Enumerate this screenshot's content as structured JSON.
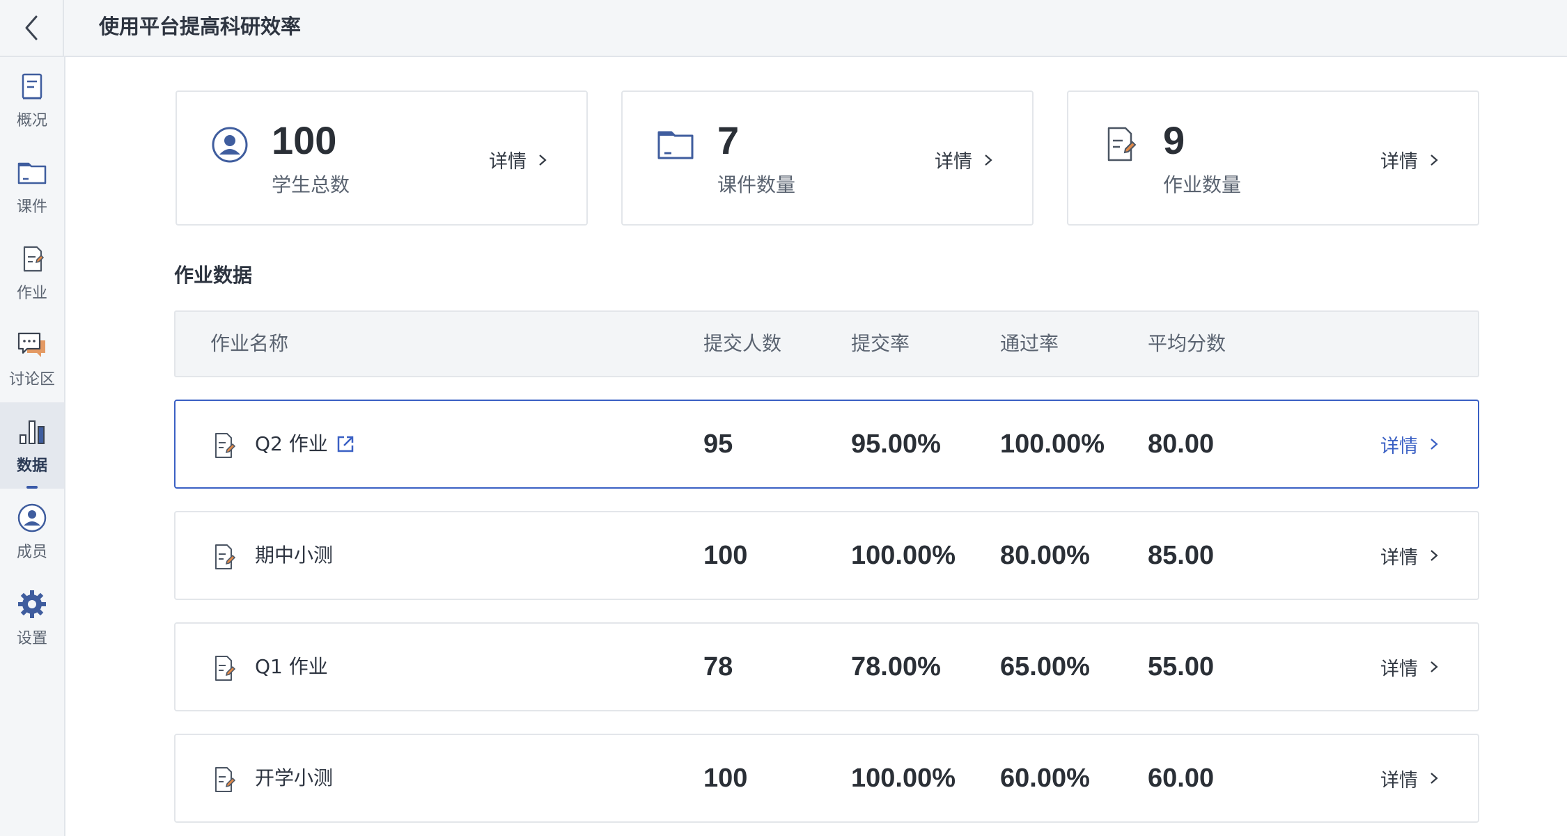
{
  "header": {
    "title": "使用平台提高科研效率",
    "back_icon": "chevron-left-icon"
  },
  "sidebar": {
    "items": [
      {
        "label": "概况",
        "icon": "overview-doc-icon"
      },
      {
        "label": "课件",
        "icon": "folder-icon"
      },
      {
        "label": "作业",
        "icon": "assignment-icon"
      },
      {
        "label": "讨论区",
        "icon": "chat-icon"
      },
      {
        "label": "数据",
        "icon": "bar-chart-icon",
        "active": true
      },
      {
        "label": "成员",
        "icon": "user-icon"
      },
      {
        "label": "设置",
        "icon": "gear-icon"
      }
    ]
  },
  "stats": [
    {
      "value": "100",
      "label": "学生总数",
      "detail": "详情",
      "icon": "user-icon"
    },
    {
      "value": "7",
      "label": "课件数量",
      "detail": "详情",
      "icon": "folder-icon"
    },
    {
      "value": "9",
      "label": "作业数量",
      "detail": "详情",
      "icon": "assignment-icon"
    }
  ],
  "section": {
    "title": "作业数据"
  },
  "table": {
    "columns": [
      "作业名称",
      "提交人数",
      "提交率",
      "通过率",
      "平均分数"
    ],
    "rows": [
      {
        "name": "Q2 作业",
        "submitted": "95",
        "submit_rate": "95.00%",
        "pass_rate": "100.00%",
        "avg": "80.00",
        "detail": "详情",
        "selected": true,
        "external_link": true
      },
      {
        "name": "期中小测",
        "submitted": "100",
        "submit_rate": "100.00%",
        "pass_rate": "80.00%",
        "avg": "85.00",
        "detail": "详情"
      },
      {
        "name": "Q1 作业",
        "submitted": "78",
        "submit_rate": "78.00%",
        "pass_rate": "65.00%",
        "avg": "55.00",
        "detail": "详情"
      },
      {
        "name": "开学小测",
        "submitted": "100",
        "submit_rate": "100.00%",
        "pass_rate": "60.00%",
        "avg": "60.00",
        "detail": "详情"
      }
    ]
  },
  "colors": {
    "accent": "#3a60c4",
    "icon_fill": "#3f5d9e",
    "icon_accent": "#e08a4a"
  }
}
